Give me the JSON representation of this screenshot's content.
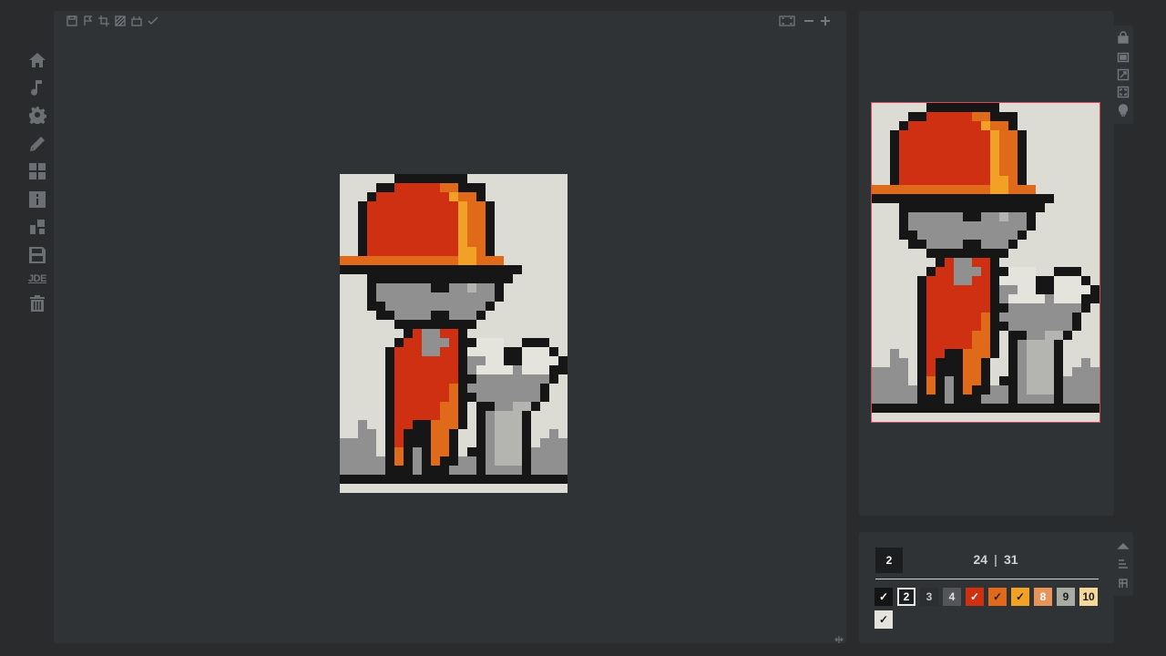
{
  "sidebar": {
    "items": [
      {
        "name": "home-icon"
      },
      {
        "name": "music-icon"
      },
      {
        "name": "gear-icon"
      },
      {
        "name": "pencil-icon"
      },
      {
        "name": "gallery-icon"
      },
      {
        "name": "info-icon"
      },
      {
        "name": "share-icon"
      },
      {
        "name": "save-icon"
      },
      {
        "name": "jde-link",
        "label": "JDE"
      },
      {
        "name": "trash-icon"
      }
    ]
  },
  "toolbar": {
    "tools": [
      "save-icon",
      "flag-icon",
      "crop-icon",
      "hatch-icon",
      "fill-icon",
      "check-icon"
    ],
    "view_tools": [
      "fullscreen-icon",
      "zoom-out-icon",
      "zoom-in-icon"
    ]
  },
  "preview_tools": [
    "lock-icon",
    "frame-icon",
    "expand-icon",
    "fit-icon",
    "bulb-icon"
  ],
  "palette_tools": [
    "up-icon",
    "sort-icon",
    "text-icon"
  ],
  "status": {
    "selected_color": "2",
    "filled": "24",
    "separator": "|",
    "total": "31"
  },
  "palette": [
    {
      "label": "✓",
      "bg": "#141414",
      "fg": "#ffffff",
      "done": true
    },
    {
      "label": "2",
      "bg": "#1e1f21",
      "fg": "#ffffff",
      "selected": true
    },
    {
      "label": "3",
      "bg": "#2c2e30",
      "fg": "#c8c8c8"
    },
    {
      "label": "4",
      "bg": "#535557",
      "fg": "#e4e4e4"
    },
    {
      "label": "✓",
      "bg": "#d03012",
      "fg": "#ffffff",
      "done": true
    },
    {
      "label": "✓",
      "bg": "#e06a1a",
      "fg": "#1a1a1a",
      "done": true
    },
    {
      "label": "✓",
      "bg": "#f1a226",
      "fg": "#1a1a1a",
      "done": true
    },
    {
      "label": "8",
      "bg": "#e8935a",
      "fg": "#ffffff"
    },
    {
      "label": "9",
      "bg": "#a8aaa4",
      "fg": "#1a1a1a"
    },
    {
      "label": "10",
      "bg": "#f5d79a",
      "fg": "#1a1a1a"
    },
    {
      "label": "✓",
      "bg": "#e4e3dc",
      "fg": "#1a1a1a",
      "done": true
    }
  ],
  "picture": {
    "cols": 25,
    "rows": 35,
    "colors": {
      ".": "#dcdcd4",
      "B": "#161616",
      "R": "#d03012",
      "O": "#e06a1a",
      "Y": "#f1a226",
      "G": "#909090",
      "L": "#b4b4b0",
      "W": "#e4e3dc",
      "D": "#2a2a2a"
    },
    "rows_data": [
      "......BBBBBBBB...........",
      "....BBRRRRROOBBB.........",
      "...BRRRRRRRRYOOB.........",
      "..BRRRRRRRRRRYOOB........",
      "..BRRRRRRRRRRYOOB........",
      "..BRRRRRRRRRRYOOB........",
      "..BRRRRRRRRRRYOOB........",
      "..BRRRRRRRRRRYOOB........",
      "..BRRRRRRRRRRYYOB........",
      "OOOOOOOOOOOOOYYOOO.......",
      "BBBBBBBBBBBBBBBBBBBB.....",
      "...BBBBBBBBBBBBBBBB......",
      "...BGGGGGGBBGGLGGB.......",
      "...BGGGGGGGGGGGGGB.......",
      "...BBGGGGGGGGGGGB........",
      "....BBGGGGBBGGGB.........",
      "......BBBBBBBBB..........",
      ".......BRGGRRB...........",
      "......BRRGGGRBBWWW..BBB..",
      ".....BRRRGGRRBWWWWBBWWWB.",
      ".....BRRRRRRRBGGWWBBWWWWB",
      ".....BRRRRRRRBGWWWWGWWWBB",
      ".....BRRRRRRRBBGGGGGGGGB.",
      ".....BRRRRRROBGGGGGGGGB..",
      ".....BRRRRRROBBGGGGGGGB..",
      ".....BRRRRROOB.BBGGLLB...",
      ".....BRRRRROOB.BGLLLB....",
      "..G..BRRBBOOOB.BGLLLB....",
      "..GG.BRBBBOOB..BGLLLB..G.",
      "GGGG.BRBBBOOB..BGLLLB.GGG",
      "GGGG.BOBGBOOB.BBGLLLBGGGG",
      "GGGGGBOBGBOBBGGBGLLLBGGGG",
      "GGGGGBBBGBBBGGGBGGGGBGGGG",
      "BBBBBBBBBBBBBBBBBBBBBBBBB",
      "........................."
    ]
  }
}
